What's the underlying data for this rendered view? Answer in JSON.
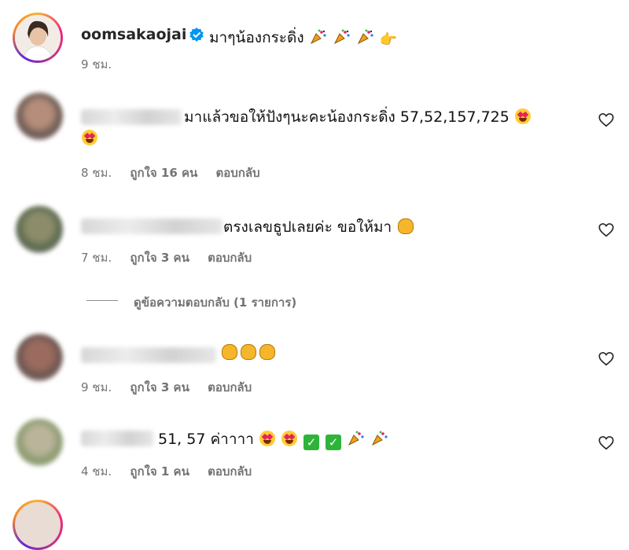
{
  "post": {
    "author": "oomsakaojai",
    "caption": "มาๆน้องกระดิ่ง",
    "caption_emojis": [
      "party-popper-icon",
      "party-popper-icon",
      "party-popper-icon",
      "pointing-hand-icon"
    ],
    "time": "9 ชม."
  },
  "comments": [
    {
      "text": "มาแล้วขอให้ปังๆนะคะน้องกระดิ่ง 57,52,157,725",
      "time": "8 ชม.",
      "likes": "ถูกใจ 16 คน",
      "reply": "ตอบกลับ"
    },
    {
      "text": "ตรงเลขธูปเลยค่ะ ขอให้มา",
      "time": "7 ชม.",
      "likes": "ถูกใจ 3 คน",
      "reply": "ตอบกลับ"
    },
    {
      "text": "",
      "time": "9 ชม.",
      "likes": "ถูกใจ 3 คน",
      "reply": "ตอบกลับ"
    },
    {
      "text": "51, 57 ค่าาาา",
      "time": "4 ชม.",
      "likes": "ถูกใจ 1 คน",
      "reply": "ตอบกลับ"
    }
  ],
  "view_replies": "ดูข้อความตอบกลับ (1 รายการ)",
  "colors": {
    "text": "#111111",
    "meta": "#737373",
    "verified": "#0095f6",
    "story_ring": [
      "#f9b233",
      "#ee2a7b",
      "#c13584",
      "#6228d7"
    ]
  }
}
